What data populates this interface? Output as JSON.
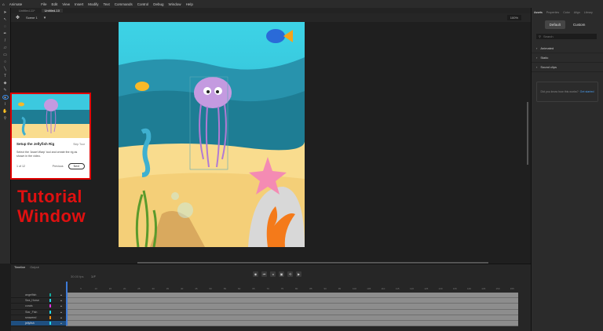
{
  "app": {
    "name": "Animate",
    "menu": [
      "File",
      "Edit",
      "View",
      "Insert",
      "Modify",
      "Text",
      "Commands",
      "Control",
      "Debug",
      "Window",
      "Help"
    ]
  },
  "doc_tabs": [
    "Untitled-11*",
    "Untitled-10"
  ],
  "scene": {
    "name": "Scene 1",
    "zoom": "100%"
  },
  "right_panel": {
    "tabs": [
      "Assets",
      "Properties",
      "Color",
      "Align",
      "Library"
    ],
    "segments": [
      "Default",
      "Custom"
    ],
    "search_placeholder": "Search",
    "sections": [
      "Animated",
      "Static",
      "Sound clips"
    ],
    "info_text": "Did you know how this works?",
    "info_link": "Get started"
  },
  "tutorial": {
    "title": "Setup the Jellyfish Rig",
    "skip": "Skip Tour",
    "body": "Select the 'Asset Warp' tool and create the rig as shown in the video.",
    "step": "1 of 12",
    "previous": "Previous",
    "next": "Next"
  },
  "annotation": {
    "line1": "Tutorial",
    "line2": "Window",
    "color": "#e01010"
  },
  "timeline": {
    "tabs": [
      "Timeline",
      "Output"
    ],
    "fps": "30.00 fps",
    "frame": "1 F",
    "layers": [
      {
        "name": "angelfish",
        "color": "#14a89a"
      },
      {
        "name": "Sea_Horse",
        "color": "#22d8e8"
      },
      {
        "name": "corals",
        "color": "#e030e0"
      },
      {
        "name": "Star_Fish",
        "color": "#22d8e8"
      },
      {
        "name": "seaweed",
        "color": "#f08a10"
      },
      {
        "name": "jellyfish",
        "color": "#22d8e8"
      }
    ],
    "selected_layer": "jellyfish",
    "frame_labels": [
      "5",
      "10",
      "15",
      "20",
      "25",
      "30",
      "35",
      "40",
      "45",
      "50",
      "55",
      "60",
      "65",
      "70",
      "75",
      "80",
      "85",
      "90",
      "95",
      "100",
      "105",
      "110",
      "115",
      "120",
      "125",
      "130",
      "135",
      "140",
      "145",
      "150",
      "155"
    ]
  }
}
